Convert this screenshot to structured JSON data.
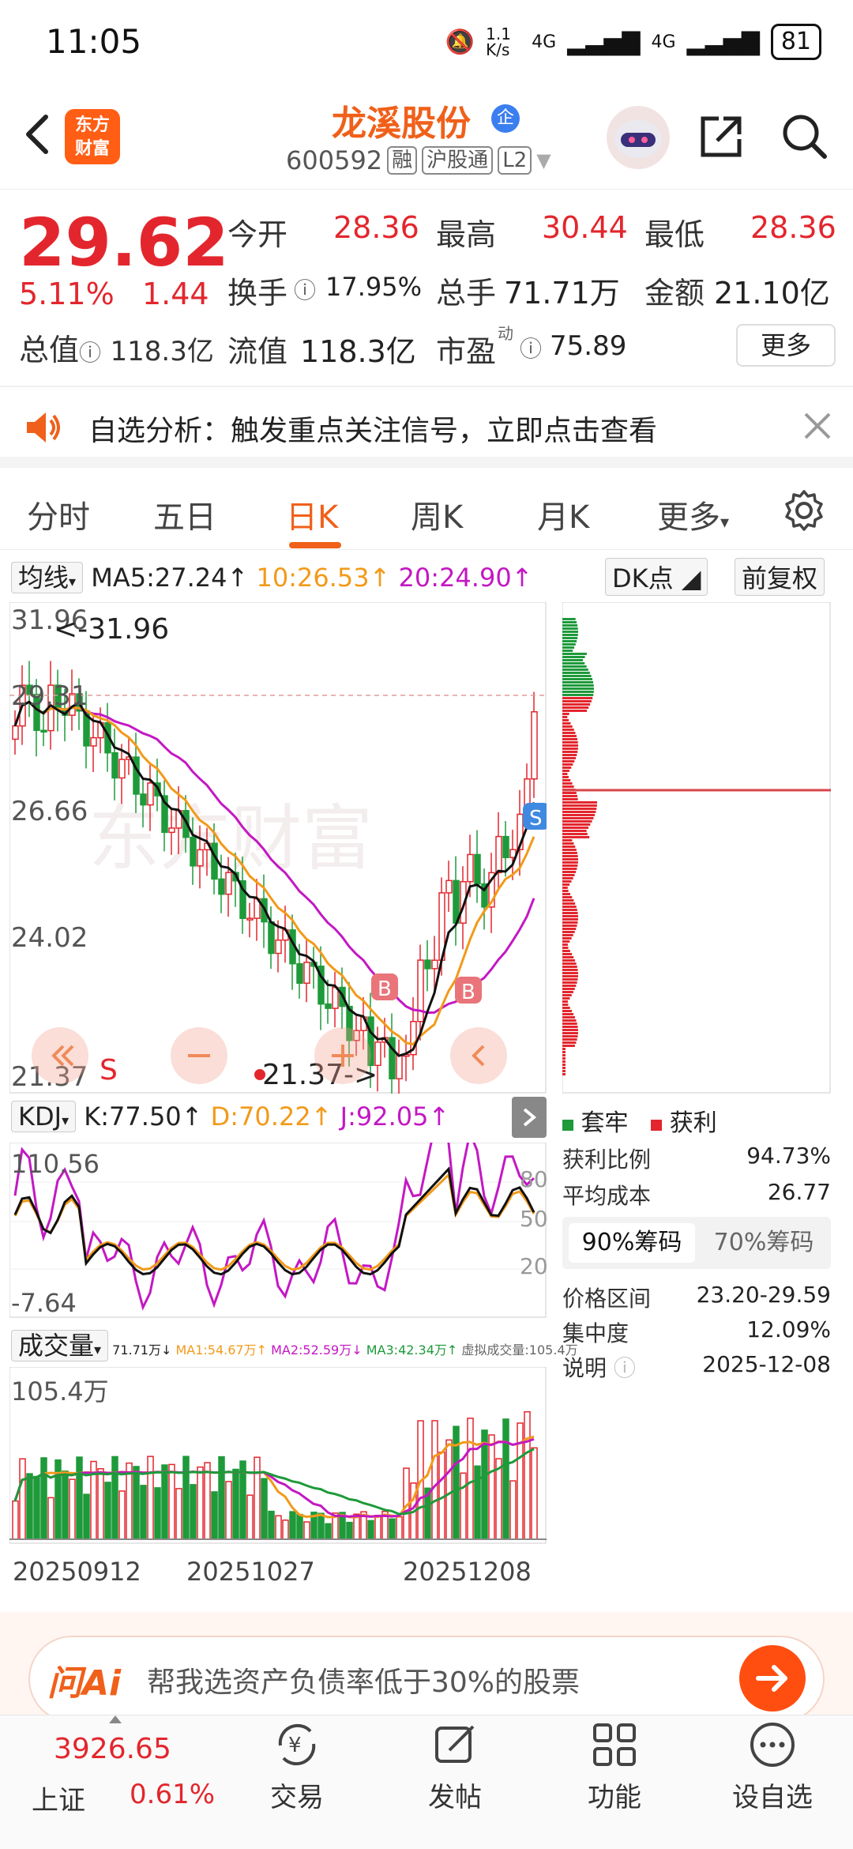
{
  "status_bar": {
    "time": "11:05",
    "net_speed": "1.1 K/s",
    "signal1": "4G",
    "signal2": "4G",
    "battery": "81"
  },
  "header": {
    "logo_line1": "东方",
    "logo_line2": "财富",
    "stock_name": "龙溪股份",
    "verified_badge": "企",
    "stock_code": "600592",
    "tags": [
      "融",
      "沪股通",
      "L2"
    ]
  },
  "quote": {
    "price": "29.62",
    "change_pct": "5.11%",
    "change_amt": "1.44",
    "total_value_label": "总值",
    "total_value": "118.3亿",
    "fields": [
      {
        "label": "今开",
        "value": "28.36"
      },
      {
        "label": "最高",
        "value": "30.44"
      },
      {
        "label": "最低",
        "value": "28.36"
      },
      {
        "label": "换手",
        "value": "17.95%"
      },
      {
        "label": "总手",
        "value": "71.71万"
      },
      {
        "label": "金额",
        "value": "21.10亿"
      },
      {
        "label": "流值",
        "value": "118.3亿"
      },
      {
        "label": "市盈",
        "label_sup": "动",
        "value": "75.89"
      }
    ],
    "more_button": "更多"
  },
  "banner": {
    "text": "自选分析：触发重点关注信号，立即点击查看"
  },
  "tabs": [
    {
      "label": "分时"
    },
    {
      "label": "五日"
    },
    {
      "label": "日K"
    },
    {
      "label": "周K"
    },
    {
      "label": "月K"
    },
    {
      "label": "更多"
    }
  ],
  "ma_legend": {
    "selector": "均线",
    "ma5": "MA5:27.24↑",
    "ma10": "10:26.53↑",
    "ma20": "20:24.90↑",
    "dk_button": "DK点",
    "adjust_button": "前复权"
  },
  "kline": {
    "axis_labels": [
      "31.96",
      "29.31",
      "26.66",
      "24.02",
      "21.37"
    ],
    "high_annotation": "<-31.96",
    "low_annotation": "21.37->",
    "s_marker": "S",
    "b_marker": "B",
    "sell_label": "S",
    "watermark": "东方财富"
  },
  "kdj_legend": {
    "selector": "KDJ",
    "k": "K:77.50↑",
    "d": "D:70.22↑",
    "j": "J:92.05↑"
  },
  "kdj_axis": {
    "max": "110.56",
    "min": "-7.64",
    "levels": [
      "80",
      "50",
      "20"
    ]
  },
  "volume_legend": {
    "selector": "成交量",
    "vol": "71.71万↓",
    "ma1": "MA1:54.67万↑",
    "ma2": "MA2:52.59万↓",
    "ma3": "MA3:42.34万↑",
    "virtual": "虚拟成交量:105.4万"
  },
  "volume_axis": {
    "max": "105.4万"
  },
  "dates": [
    "20250912",
    "20251027",
    "20251208"
  ],
  "chips": {
    "legend_locked": "套牢",
    "legend_profit": "获利",
    "profit_ratio_label": "获利比例",
    "profit_ratio": "94.73%",
    "avg_cost_label": "平均成本",
    "avg_cost": "26.77",
    "tab90": "90%筹码",
    "tab70": "70%筹码",
    "price_range_label": "价格区间",
    "price_range": "23.20-29.59",
    "concentration_label": "集中度",
    "concentration": "12.09%",
    "note_label": "说明",
    "note_date": "2025-12-08"
  },
  "ai": {
    "logo": "问Ai",
    "placeholder": "帮我选资产负债率低于30%的股票"
  },
  "bottom_nav": {
    "index_value": "3926.65",
    "index_name": "上证",
    "index_pct": "0.61%",
    "items": [
      {
        "label": "交易"
      },
      {
        "label": "发帖"
      },
      {
        "label": "功能"
      },
      {
        "label": "设自选"
      }
    ]
  },
  "colors": {
    "up": "#e3262d",
    "down": "#1e9a3a",
    "accent": "#f0601a",
    "ma5": "#111111",
    "ma10": "#f29a1a",
    "ma20": "#c318c3"
  }
}
